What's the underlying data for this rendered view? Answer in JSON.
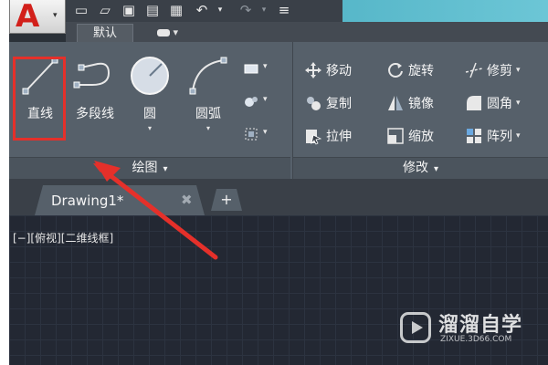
{
  "app": {
    "logo_letter": "A",
    "colors": {
      "accent_red": "#e5302a",
      "titlebar_cyan": "#6cc6d6"
    }
  },
  "quick_access": [
    "new-file-icon",
    "open-folder-icon",
    "save-icon",
    "save-as-icon",
    "print-icon",
    "undo-icon",
    "redo-icon",
    "customize-icon"
  ],
  "ribbon": {
    "tabs": [
      {
        "label": "默认"
      }
    ],
    "draw_panel": {
      "title": "绘图",
      "tools": [
        {
          "label": "直线",
          "icon": "line-icon"
        },
        {
          "label": "多段线",
          "icon": "polyline-icon"
        },
        {
          "label": "圆",
          "icon": "circle-icon"
        },
        {
          "label": "圆弧",
          "icon": "arc-icon"
        }
      ],
      "small_tools": [
        "rectangle-icon",
        "hatch-icon",
        "boundary-icon"
      ]
    },
    "modify_panel": {
      "title": "修改",
      "tools": [
        {
          "label": "移动",
          "icon": "move-icon"
        },
        {
          "label": "旋转",
          "icon": "rotate-icon"
        },
        {
          "label": "修剪",
          "icon": "trim-icon"
        },
        {
          "label": "复制",
          "icon": "copy-icon"
        },
        {
          "label": "镜像",
          "icon": "mirror-icon"
        },
        {
          "label": "圆角",
          "icon": "fillet-icon"
        },
        {
          "label": "拉伸",
          "icon": "stretch-icon"
        },
        {
          "label": "缩放",
          "icon": "scale-icon"
        },
        {
          "label": "阵列",
          "icon": "array-icon"
        }
      ]
    }
  },
  "document": {
    "tab_title": "Drawing1*",
    "close_glyph": "✖",
    "new_tab_glyph": "+"
  },
  "viewport": {
    "label": "[−][俯视][二维线框]"
  },
  "watermark": {
    "text": "溜溜自学",
    "url": "ZIXUE.3D66.COM"
  }
}
